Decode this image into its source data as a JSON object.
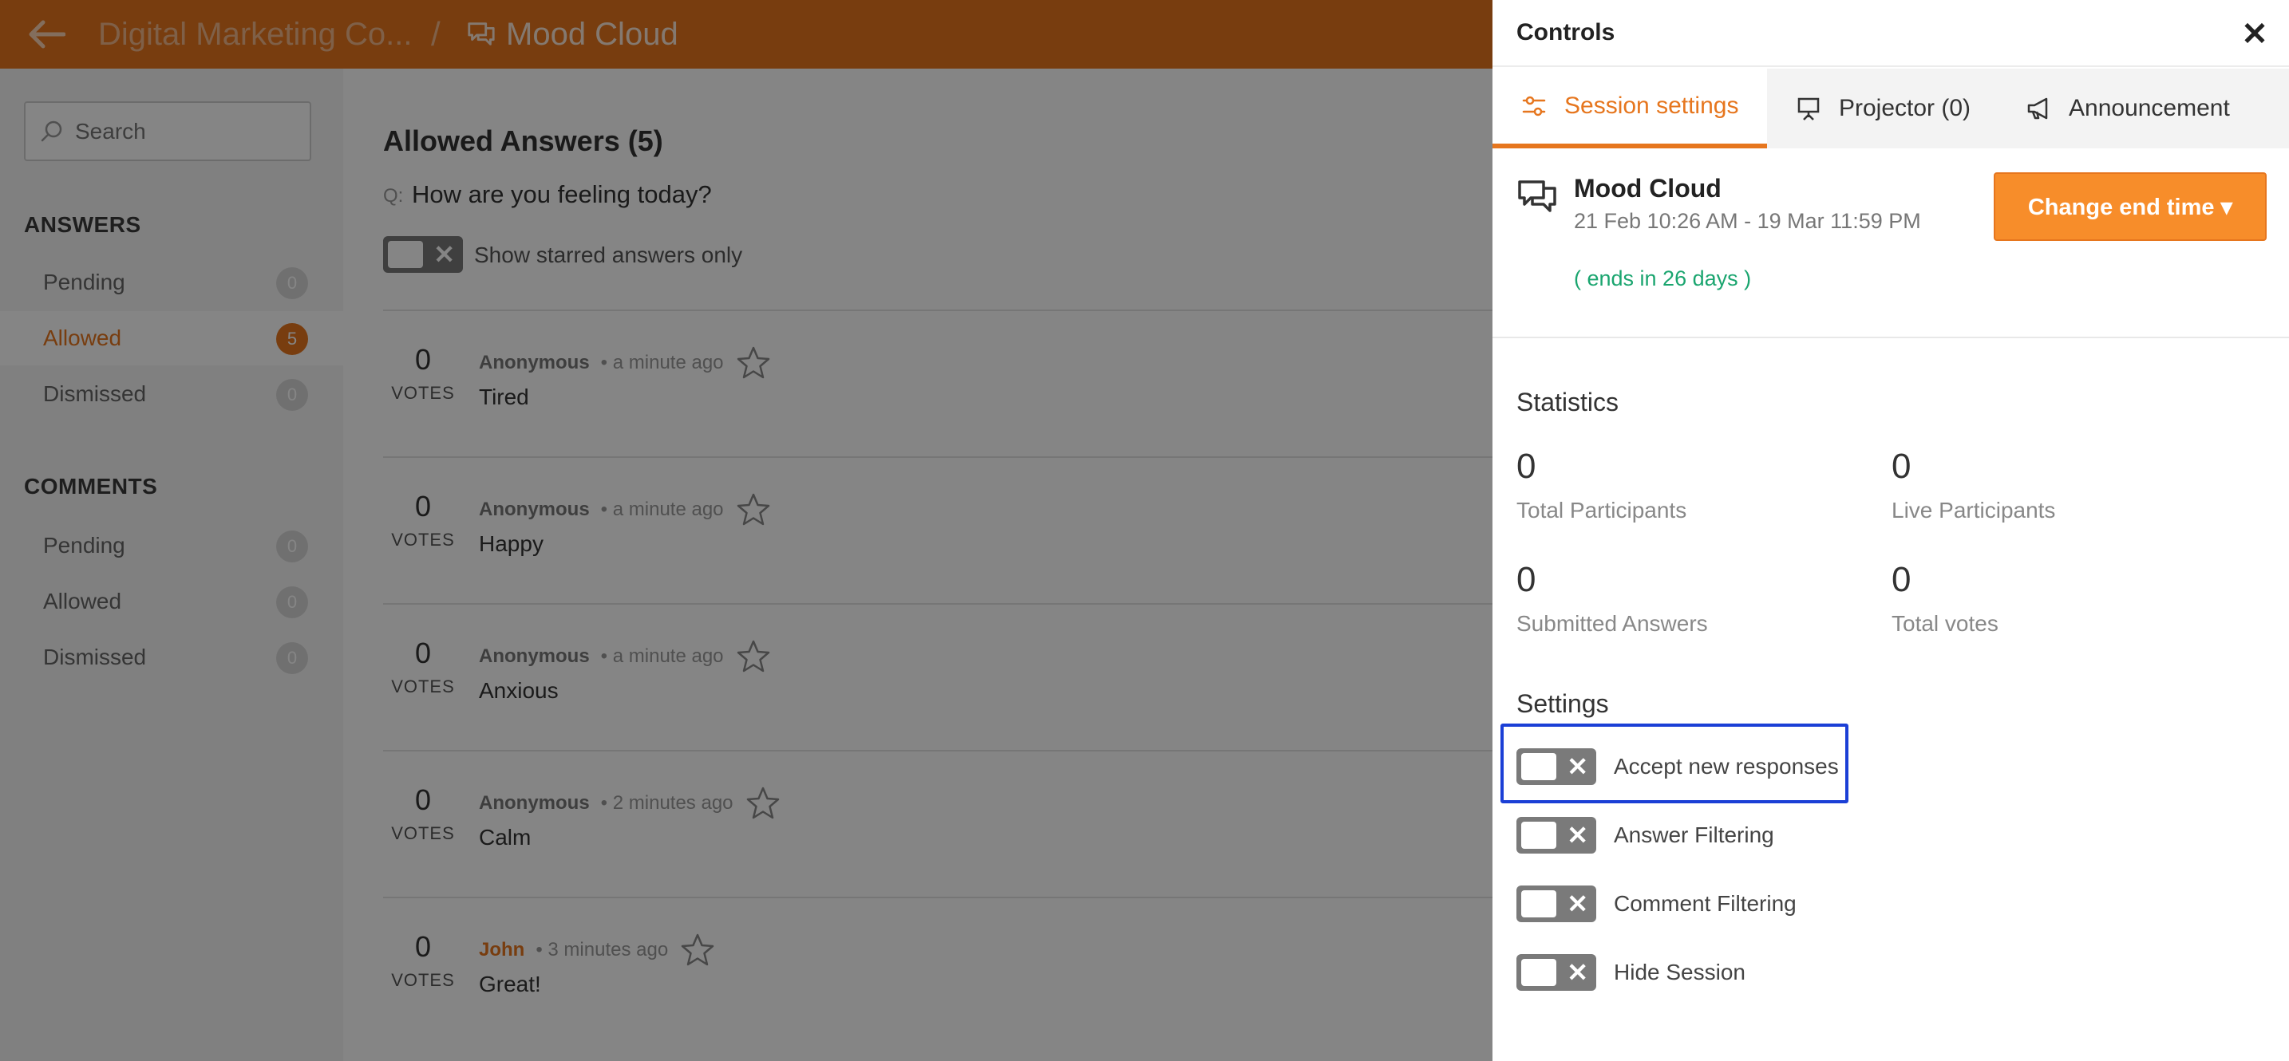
{
  "header": {
    "project": "Digital Marketing Co...",
    "separator": "/",
    "title": "Mood Cloud"
  },
  "sidebar": {
    "search_placeholder": "Search",
    "answers_heading": "ANSWERS",
    "answers_items": [
      {
        "label": "Pending",
        "count": "0"
      },
      {
        "label": "Allowed",
        "count": "5"
      },
      {
        "label": "Dismissed",
        "count": "0"
      }
    ],
    "comments_heading": "COMMENTS",
    "comments_items": [
      {
        "label": "Pending",
        "count": "0"
      },
      {
        "label": "Allowed",
        "count": "0"
      },
      {
        "label": "Dismissed",
        "count": "0"
      }
    ]
  },
  "main": {
    "title": "Allowed Answers (5)",
    "question_prefix": "Q:",
    "question": "How are you feeling today?",
    "starred_label": "Show starred answers only",
    "votes_label": "VOTES",
    "answers": [
      {
        "votes": "0",
        "author": "Anonymous",
        "time": "a minute ago",
        "text": "Tired"
      },
      {
        "votes": "0",
        "author": "Anonymous",
        "time": "a minute ago",
        "text": "Happy"
      },
      {
        "votes": "0",
        "author": "Anonymous",
        "time": "a minute ago",
        "text": "Anxious"
      },
      {
        "votes": "0",
        "author": "Anonymous",
        "time": "2 minutes ago",
        "text": "Calm"
      },
      {
        "votes": "0",
        "author": "John",
        "time": "3 minutes ago",
        "text": "Great!"
      }
    ]
  },
  "panel": {
    "title": "Controls",
    "close": "✕",
    "tabs": [
      {
        "label": "Session settings"
      },
      {
        "label": "Projector (0)"
      },
      {
        "label": "Announcement"
      }
    ],
    "session": {
      "name": "Mood Cloud",
      "dates": "21 Feb 10:26 AM - 19 Mar 11:59 PM",
      "ends": "( ends in 26 days )",
      "change_button": "Change end time ▾"
    },
    "statistics": {
      "heading": "Statistics",
      "items": [
        {
          "value": "0",
          "label": "Total Participants"
        },
        {
          "value": "0",
          "label": "Live Participants"
        },
        {
          "value": "0",
          "label": "Submitted Answers"
        },
        {
          "value": "0",
          "label": "Total votes"
        }
      ]
    },
    "settings": {
      "heading": "Settings",
      "toggle_off_symbol": "✕",
      "items": [
        {
          "label": "Accept new responses"
        },
        {
          "label": "Answer Filtering"
        },
        {
          "label": "Comment Filtering"
        },
        {
          "label": "Hide Session"
        }
      ]
    }
  },
  "colors": {
    "brand": "#e6761e",
    "button": "#f78d2a",
    "success": "#1aa56f",
    "highlight": "#1b3fd6"
  }
}
